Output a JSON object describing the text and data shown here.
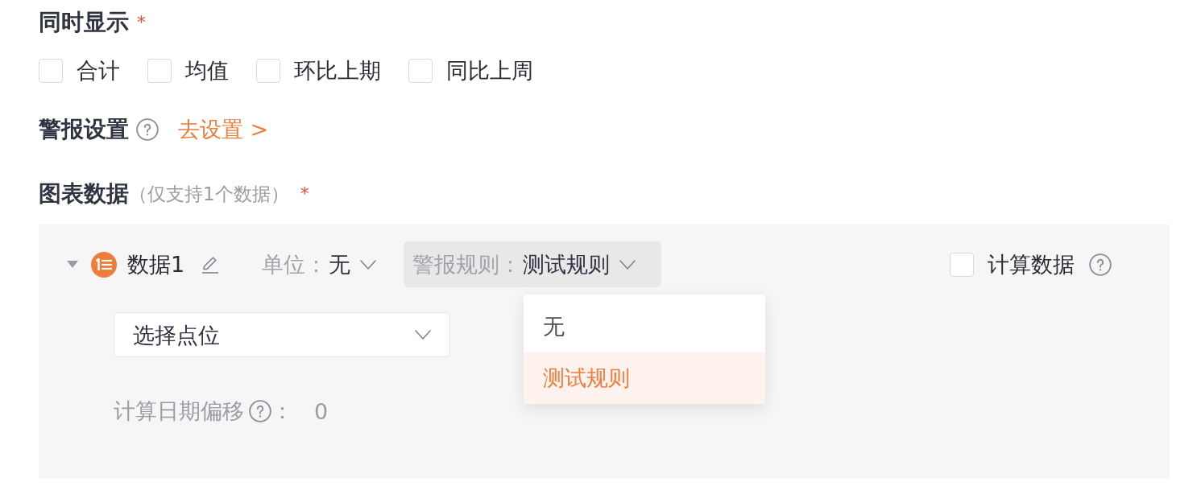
{
  "display_options": {
    "title": "同时显示",
    "required_mark": "*",
    "options": [
      {
        "label": "合计",
        "checked": false
      },
      {
        "label": "均值",
        "checked": false
      },
      {
        "label": "环比上期",
        "checked": false
      },
      {
        "label": "同比上周",
        "checked": false
      }
    ]
  },
  "alert_settings": {
    "title": "警报设置",
    "link": "去设置 >"
  },
  "data_section": {
    "title": "图表数据",
    "note": "（仅支持1个数据）",
    "required_mark": "*",
    "series": [
      {
        "name": "数据1",
        "expanded": true,
        "unit": {
          "label": "单位：",
          "value": "无"
        },
        "alert_rule": {
          "label": "警报规则：",
          "value": "测试规则",
          "expanded": true,
          "options": [
            {
              "label": "无",
              "selected": false
            },
            {
              "label": "测试规则",
              "selected": true
            }
          ]
        },
        "calculated": {
          "label": "计算数据",
          "checked": false
        },
        "point_select": {
          "placeholder": "选择点位"
        },
        "date_offset": {
          "label": "计算日期偏移",
          "colon": "：",
          "value": "0"
        }
      }
    ]
  }
}
